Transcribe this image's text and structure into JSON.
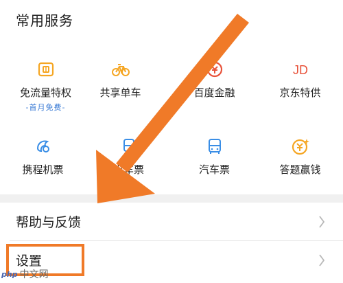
{
  "section": {
    "title": "常用服务"
  },
  "services": [
    {
      "label": "免流量特权",
      "sub": "-首月免费-",
      "icon": "sim-card-icon",
      "color": "#f5a623"
    },
    {
      "label": "共享单车",
      "icon": "bicycle-icon",
      "color": "#f5a623"
    },
    {
      "label": "百度金融",
      "icon": "finance-icon",
      "color": "#e8523a"
    },
    {
      "label": "京东特供",
      "icon": "jd-logo-icon",
      "color": "#e8523a"
    },
    {
      "label": "携程机票",
      "icon": "ctrip-dolphin-icon",
      "color": "#3a8ee6"
    },
    {
      "label": "火车票",
      "icon": "train-icon",
      "color": "#3a8ee6"
    },
    {
      "label": "汽车票",
      "icon": "bus-icon",
      "color": "#3a8ee6"
    },
    {
      "label": "答题赢钱",
      "icon": "yuan-coin-icon",
      "color": "#f5a623"
    }
  ],
  "rows": {
    "help": "帮助与反馈",
    "settings": "设置"
  },
  "annotation": {
    "arrow_color": "#f07a28",
    "box_color": "#f07a28"
  },
  "watermark": {
    "logo": "php",
    "text": "中文网"
  }
}
